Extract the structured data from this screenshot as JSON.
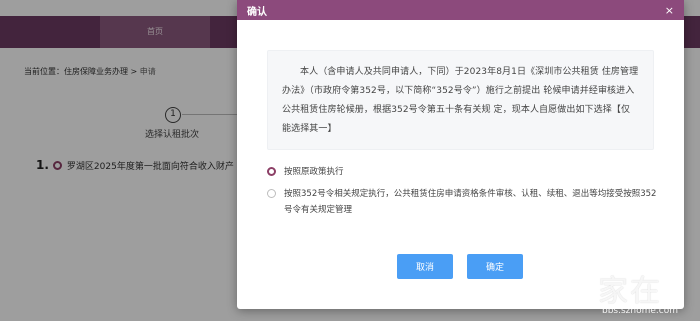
{
  "background": {
    "nav_home": "首页",
    "breadcrumb_prefix": "当前位置：",
    "breadcrumb_section": "住房保障业务办理",
    "breadcrumb_sep": " > ",
    "breadcrumb_current": "申请",
    "step_number": "1",
    "step_label": "选择认租批次",
    "item_number": "1.",
    "item_text": "罗湖区2025年度第一批面向符合收入财产"
  },
  "dialog": {
    "title": "确认",
    "close_glyph": "×",
    "notice": "本人（含申请人及共同申请人，下同）于2023年8月1日《深圳市公共租赁 住房管理办法》（市政府令第352号，以下简称“352号令”）施行之前提出 轮候申请并经审核进入公共租赁住房轮候册，根据352号令第五十条有关规 定，现本人自愿做出如下选择【仅能选择其一】",
    "options": [
      {
        "label": "按照原政策执行",
        "checked": true
      },
      {
        "label": "按照352号令相关规定执行，公共租赁住房申请资格条件审核、认租、续租、退出等均接受按照352号令有关规定管理",
        "checked": false
      }
    ],
    "cancel_label": "取消",
    "confirm_label": "确定"
  },
  "watermark": {
    "big": "家在",
    "small": "深圳",
    "url": "bbs.szhome.com"
  },
  "colors": {
    "brand": "#8c4a7c",
    "button": "#4a9ef5"
  }
}
